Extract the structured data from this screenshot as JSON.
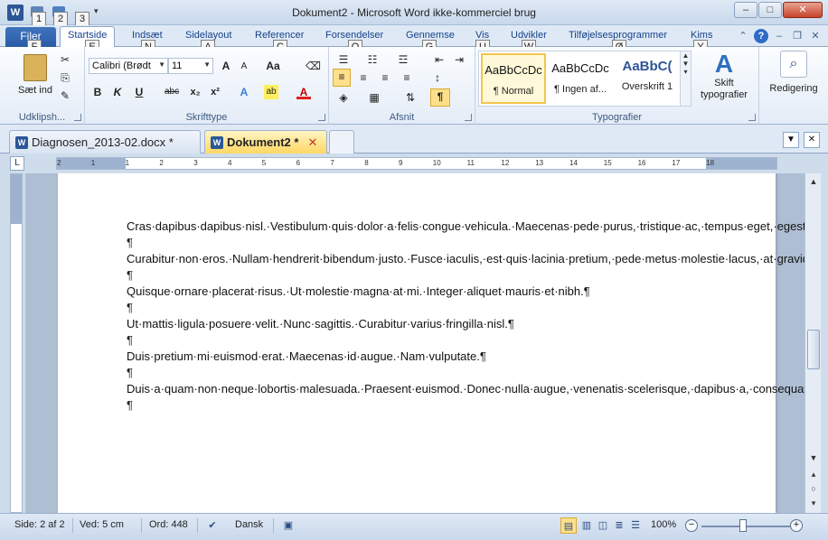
{
  "window": {
    "title": "Dokument2 - Microsoft Word ikke-kommerciel brug",
    "app_icon": "W",
    "controls": {
      "minimize": "–",
      "maximize": "□",
      "close": "✕"
    }
  },
  "quick_access": {
    "keytips": [
      "1",
      "2",
      "3"
    ],
    "icons": [
      "save-icon",
      "undo-icon",
      "redo-icon",
      "customize-icon"
    ]
  },
  "ribbon_tabs": {
    "file": "Filer",
    "file_keytip": "F",
    "tabs": [
      {
        "label": "Startside",
        "keytip": "E",
        "active": true
      },
      {
        "label": "Indsæt",
        "keytip": "N"
      },
      {
        "label": "Sidelayout",
        "keytip": "A"
      },
      {
        "label": "Referencer",
        "keytip": "C"
      },
      {
        "label": "Forsendelser",
        "keytip": "O"
      },
      {
        "label": "Gennemse",
        "keytip": "G"
      },
      {
        "label": "Vis",
        "keytip": "U"
      },
      {
        "label": "Udvikler",
        "keytip": "W"
      },
      {
        "label": "Tilføjelsesprogrammer",
        "keytip": "Ø"
      },
      {
        "label": "Kims",
        "keytip": "Y"
      }
    ]
  },
  "ribbon": {
    "clipboard": {
      "label": "Udklipsh...",
      "paste_label": "Sæt ind"
    },
    "font": {
      "label": "Skrifttype",
      "name": "Calibri (Brødt",
      "size": "11"
    },
    "paragraph": {
      "label": "Afsnit"
    },
    "styles": {
      "label": "Typografier",
      "tiles": [
        {
          "sample": "AaBbCcDc",
          "name": "¶ Normal",
          "selected": true
        },
        {
          "sample": "AaBbCcDc",
          "name": "¶ Ingen af..."
        },
        {
          "sample": "AaBbC(",
          "name": "Overskrift 1"
        }
      ],
      "change_styles": "Skift typografier"
    },
    "editing": {
      "label": "Redigering"
    }
  },
  "doc_tabs": [
    {
      "label": "Diagnosen_2013-02.docx *",
      "active": false
    },
    {
      "label": "Dokument2 *",
      "active": true,
      "close": "✕"
    }
  ],
  "ruler": {
    "ticks": [
      "2",
      "1",
      "1",
      "2",
      "3",
      "4",
      "5",
      "6",
      "7",
      "8",
      "9",
      "10",
      "11",
      "12",
      "13",
      "14",
      "15",
      "16",
      "17",
      "18"
    ]
  },
  "document": {
    "paragraphs": [
      "Cras·dapibus·dapibus·nisl.·Vestibulum·quis·dolor·a·felis·congue·vehicula.·Maecenas·pede·purus,·tristique·ac,·tempus·eget,·egestas·quis,·mauris.¶",
      "¶",
      "Curabitur·non·eros.·Nullam·hendrerit·bibendum·justo.·Fusce·iaculis,·est·quis·lacinia·pretium,·pede·metus·molestie·lacus,·at·gravida·wisi·ante·at·libero.¶",
      "¶",
      "Quisque·ornare·placerat·risus.·Ut·molestie·magna·at·mi.·Integer·aliquet·mauris·et·nibh.¶",
      "¶",
      "Ut·mattis·ligula·posuere·velit.·Nunc·sagittis.·Curabitur·varius·fringilla·nisl.¶",
      "¶",
      "Duis·pretium·mi·euismod·erat.·Maecenas·id·augue.·Nam·vulputate.¶",
      "¶",
      "Duis·a·quam·non·neque·lobortis·malesuada.·Praesent·euismod.·Donec·nulla·augue,·venenatis·scelerisque,·dapibus·a,·consequat,·leo.¶",
      "¶"
    ]
  },
  "status": {
    "page": "Side: 2 af 2",
    "at": "Ved: 5 cm",
    "words": "Ord: 448",
    "language": "Dansk",
    "zoom": "100%",
    "zoom_out": "−",
    "zoom_in": "+"
  }
}
